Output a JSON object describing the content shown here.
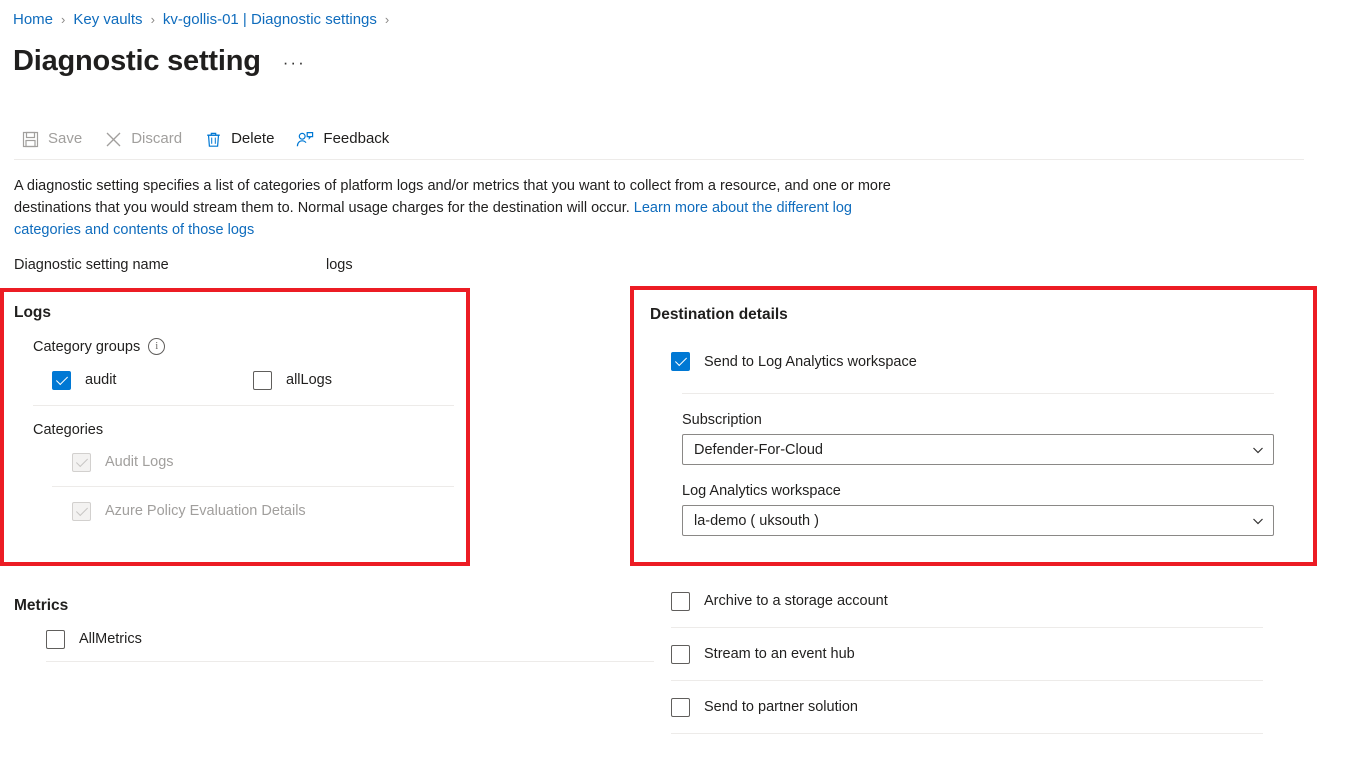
{
  "breadcrumb": {
    "items": [
      "Home",
      "Key vaults",
      "kv-gollis-01 | Diagnostic settings"
    ],
    "separator": "›"
  },
  "header": {
    "title": "Diagnostic setting",
    "ellipsis": "···"
  },
  "toolbar": {
    "save_label": "Save",
    "discard_label": "Discard",
    "delete_label": "Delete",
    "feedback_label": "Feedback",
    "save_icon": "save-floppy-icon",
    "discard_icon": "close-x-icon",
    "delete_icon": "trash-icon",
    "feedback_icon": "person-feedback-icon"
  },
  "description": {
    "text_part1": "A diagnostic setting specifies a list of categories of platform logs and/or metrics that you want to collect from a resource, and one or more destinations that you would stream them to. Normal usage charges for the destination will occur. ",
    "link_text": "Learn more about the different log categories and contents of those logs"
  },
  "setting_name": {
    "label": "Diagnostic setting name",
    "value": "logs"
  },
  "logs": {
    "heading": "Logs",
    "category_groups_label": "Category groups",
    "info_icon_glyph": "i",
    "groups": [
      {
        "label": "audit",
        "checked": true,
        "disabled": false
      },
      {
        "label": "allLogs",
        "checked": false,
        "disabled": false
      }
    ],
    "categories_label": "Categories",
    "categories": [
      {
        "label": "Audit Logs",
        "checked": true,
        "disabled": true
      },
      {
        "label": "Azure Policy Evaluation Details",
        "checked": true,
        "disabled": true
      }
    ]
  },
  "metrics": {
    "heading": "Metrics",
    "items": [
      {
        "label": "AllMetrics",
        "checked": false
      }
    ]
  },
  "destination": {
    "heading": "Destination details",
    "log_analytics": {
      "label": "Send to Log Analytics workspace",
      "checked": true
    },
    "subscription": {
      "label": "Subscription",
      "value": "Defender-For-Cloud"
    },
    "workspace": {
      "label": "Log Analytics workspace",
      "value": "la-demo ( uksouth )"
    },
    "other_options": [
      {
        "label": "Archive to a storage account",
        "checked": false
      },
      {
        "label": "Stream to an event hub",
        "checked": false
      },
      {
        "label": "Send to partner solution",
        "checked": false
      }
    ]
  },
  "colors": {
    "accent_blue": "#0078d4",
    "link_blue": "#0f6cbd",
    "highlight_red": "#ec1c24",
    "disabled_gray": "#a19f9d"
  }
}
